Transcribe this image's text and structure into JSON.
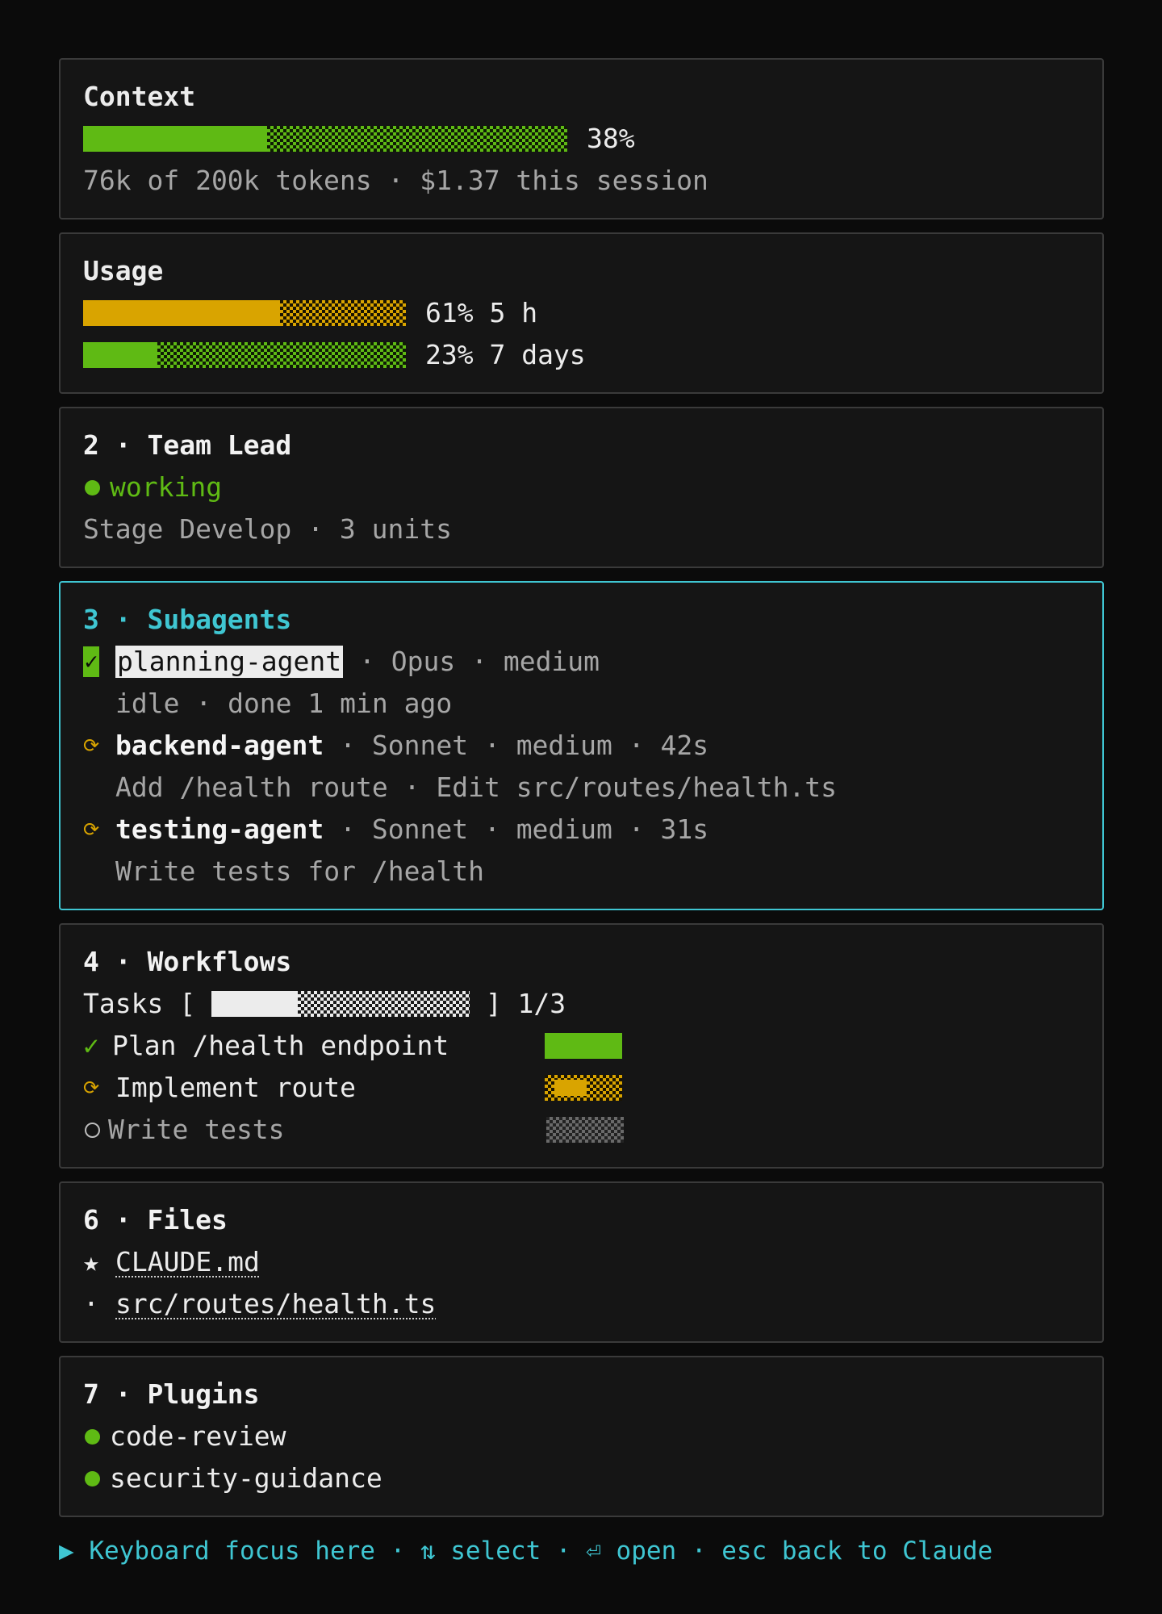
{
  "colors": {
    "background": "#0b0b0b",
    "panel": "#151515",
    "border": "#3a3a3a",
    "focus": "#3fc6d2",
    "green": "#5fba14",
    "amber": "#d9a400",
    "dim": "#a6a6a6"
  },
  "context": {
    "title": "Context",
    "percent_label": "38%",
    "percent": 0.38,
    "detail": "76k of 200k tokens · $1.37 this session"
  },
  "usage": {
    "title": "Usage",
    "rows": [
      {
        "percent": 0.61,
        "label": "61% 5 h",
        "color": "amber"
      },
      {
        "percent": 0.23,
        "label": "23% 7 days",
        "color": "green"
      }
    ]
  },
  "team_lead": {
    "title": "2 · Team Lead",
    "status": "working",
    "detail": "Stage Develop · 3 units"
  },
  "subagents": {
    "title": "3 · Subagents",
    "agents": [
      {
        "status_icon": "check-icon",
        "name": "planning-agent",
        "meta": " · Opus · medium",
        "detail": "idle · done 1 min ago"
      },
      {
        "status_icon": "spinner-icon",
        "name": "backend-agent",
        "meta": " · Sonnet · medium · 42s",
        "detail": "Add /health route · Edit src/routes/health.ts"
      },
      {
        "status_icon": "spinner-icon",
        "name": "testing-agent",
        "meta": " · Sonnet · medium · 31s",
        "detail": "Write tests for /health"
      }
    ]
  },
  "workflows": {
    "title": "4 · Workflows",
    "tasks_label": "Tasks [ ",
    "tasks_close": " ] 1/3",
    "tasks_progress": 0.333,
    "items": [
      {
        "icon": "check-icon",
        "glyph": "✓",
        "label": "Plan /health endpoint",
        "state": "done"
      },
      {
        "icon": "spinner-icon",
        "glyph": "⟳",
        "label": "Implement route",
        "state": "running"
      },
      {
        "icon": "circle-icon",
        "glyph": "",
        "label": "Write tests",
        "state": "pending"
      }
    ]
  },
  "files": {
    "title": "6 · Files",
    "items": [
      {
        "icon": "star-icon",
        "glyph": "★",
        "name": "CLAUDE.md"
      },
      {
        "icon": "bullet-icon",
        "glyph": "·",
        "name": "src/routes/health.ts"
      }
    ]
  },
  "plugins": {
    "title": "7 · Plugins",
    "items": [
      {
        "name": "code-review"
      },
      {
        "name": "security-guidance"
      }
    ]
  },
  "footer": {
    "text": "▶ Keyboard focus here · ⇅ select · ⏎ open · esc back to Claude"
  }
}
